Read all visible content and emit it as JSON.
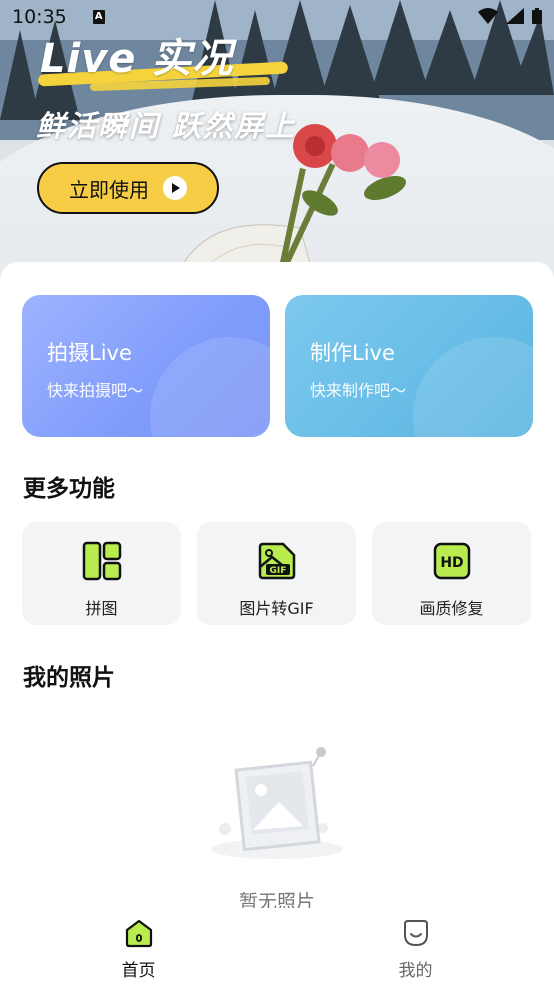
{
  "status_bar": {
    "time": "10:35",
    "badge": "A"
  },
  "hero": {
    "title": "Live 实况",
    "subtitle": "鲜活瞬间 跃然屏上",
    "cta_label": "立即使用"
  },
  "cards": {
    "shoot": {
      "title": "拍摄Live",
      "subtitle": "快来拍摄吧〜"
    },
    "make": {
      "title": "制作Live",
      "subtitle": "快来制作吧〜"
    }
  },
  "more_features": {
    "title": "更多功能",
    "items": [
      {
        "label": "拼图",
        "icon": "collage-icon"
      },
      {
        "label": "图片转GIF",
        "icon": "gif-icon"
      },
      {
        "label": "画质修复",
        "icon": "hd-icon"
      }
    ]
  },
  "my_photos": {
    "title": "我的照片",
    "empty_text": "暂无照片"
  },
  "bottom_nav": {
    "items": [
      {
        "label": "首页",
        "icon": "home-icon",
        "active": true
      },
      {
        "label": "我的",
        "icon": "profile-icon",
        "active": false
      }
    ]
  },
  "colors": {
    "accent_yellow": "#f7cd45",
    "icon_green": "#b8ec4f",
    "card_blue": "#7f9cfb",
    "card_cyan": "#67bde6"
  }
}
